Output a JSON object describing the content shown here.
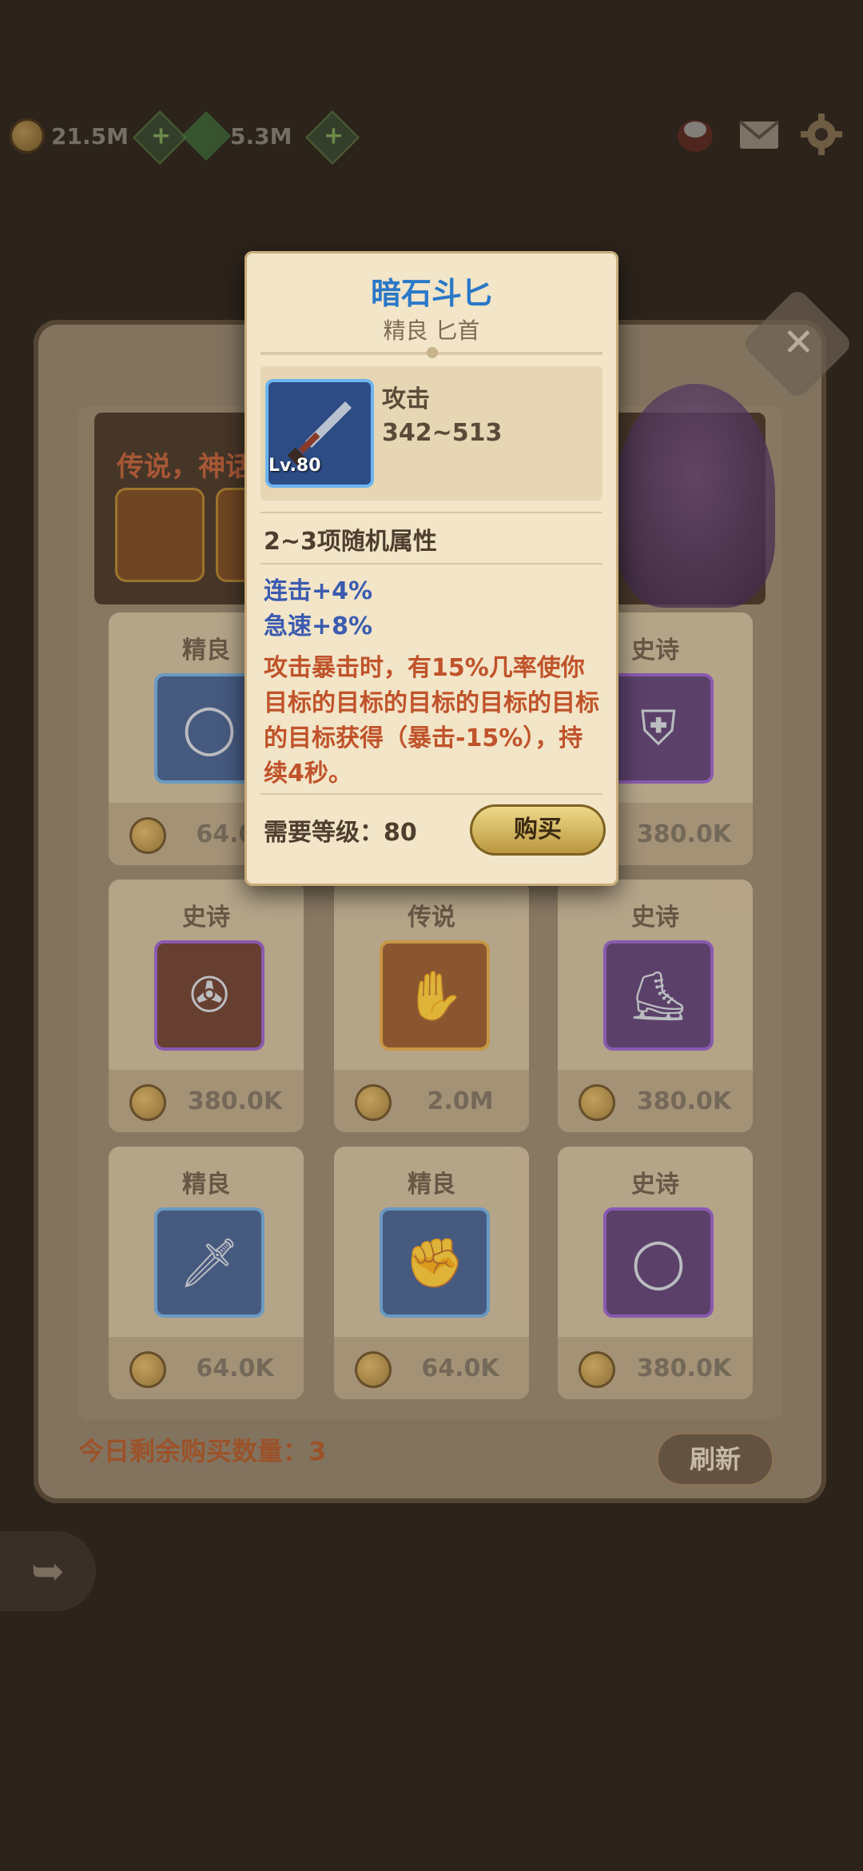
{
  "currency": {
    "gold": "21.5M",
    "gems": "5.3M"
  },
  "banner": {
    "text": "传说，神话"
  },
  "cards": [
    {
      "rarity": "精良",
      "price": "64.0K",
      "tier": "blue",
      "icon": "ring-icon"
    },
    {
      "rarity": "史诗",
      "price": "380.0K",
      "tier": "purple",
      "icon": "armor-icon"
    },
    {
      "rarity": "史诗",
      "price": "380.0K",
      "tier": "purple",
      "icon": "book-icon"
    },
    {
      "rarity": "传说",
      "price": "2.0M",
      "tier": "orange",
      "icon": "gauntlet-icon"
    },
    {
      "rarity": "史诗",
      "price": "380.0K",
      "tier": "purple",
      "icon": "boots-icon"
    },
    {
      "rarity": "精良",
      "price": "64.0K",
      "tier": "blue",
      "icon": "sword-icon"
    },
    {
      "rarity": "精良",
      "price": "64.0K",
      "tier": "blue",
      "icon": "glove-icon"
    },
    {
      "rarity": "史诗",
      "price": "380.0K",
      "tier": "purple",
      "icon": "ring-icon"
    }
  ],
  "footer": {
    "remaining": "今日剩余购买数量：3",
    "refresh": "刷新"
  },
  "tooltip": {
    "name": "暗石斗匕",
    "quality_type": "精良 匕首",
    "level": "Lv.80",
    "stat_label": "攻击",
    "stat_value": "342~513",
    "random_attrs": "2~3项随机属性",
    "attr1": "连击+4%",
    "attr2": "急速+8%",
    "effect": "攻击暴击时，有15%几率使你目标的目标的目标的目标的目标的目标获得（暴击-15%），持续4秒。",
    "requirement": "需要等级：80",
    "buy": "购买"
  }
}
